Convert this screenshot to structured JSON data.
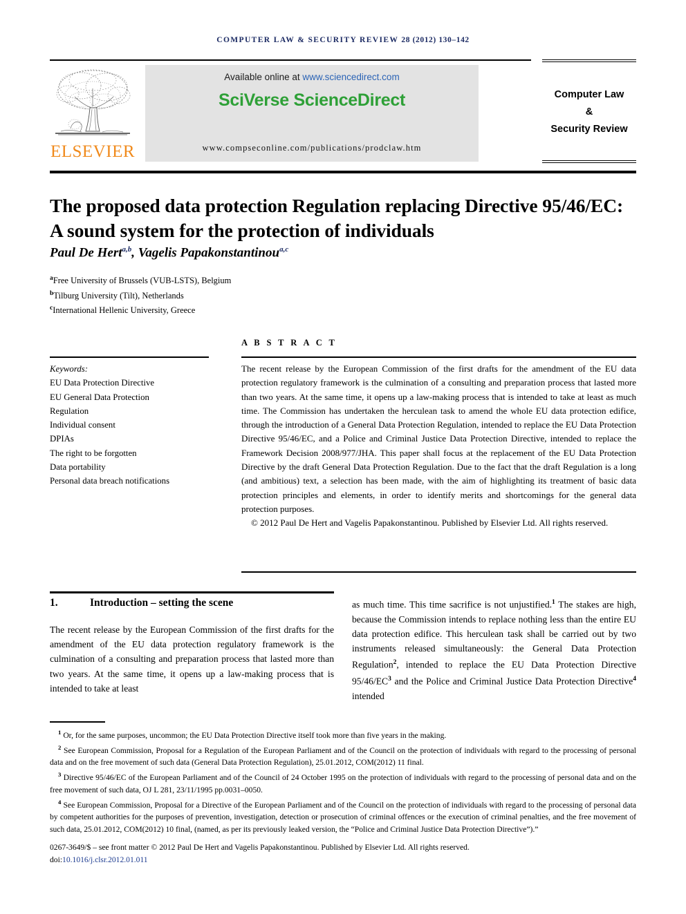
{
  "running_head": {
    "journal": "COMPUTER LAW & SECURITY REVIEW",
    "citation": "28 (2012) 130–142"
  },
  "masthead": {
    "publisher_name": "ELSEVIER",
    "available_prefix": "Available online at ",
    "sciencedirect_url": "www.sciencedirect.com",
    "platform_title": "SciVerse ScienceDirect",
    "journal_url": "www.compseconline.com/publications/prodclaw.htm",
    "journal_box": [
      "Computer Law",
      "&",
      "Security Review"
    ]
  },
  "article": {
    "title": "The proposed data protection Regulation replacing Directive 95/46/EC: A sound system for the protection of individuals",
    "authors": [
      {
        "name": "Paul De Hert",
        "marks": "a,b"
      },
      {
        "name": "Vagelis Papakonstantinou",
        "marks": "a,c"
      }
    ],
    "affiliations": [
      {
        "mark": "a",
        "text": "Free University of Brussels (VUB-LSTS), Belgium"
      },
      {
        "mark": "b",
        "text": "Tilburg University (Tilt), Netherlands"
      },
      {
        "mark": "c",
        "text": "International Hellenic University, Greece"
      }
    ]
  },
  "abstract": {
    "heading": "A B S T R A C T",
    "text": "The recent release by the European Commission of the first drafts for the amendment of the EU data protection regulatory framework is the culmination of a consulting and preparation process that lasted more than two years. At the same time, it opens up a law-making process that is intended to take at least as much time. The Commission has undertaken the herculean task to amend the whole EU data protection edifice, through the introduction of a General Data Protection Regulation, intended to replace the EU Data Protection Directive 95/46/EC, and a Police and Criminal Justice Data Protection Directive, intended to replace the Framework Decision 2008/977/JHA. This paper shall focus at the replacement of the EU Data Protection Directive by the draft General Data Protection Regulation. Due to the fact that the draft Regulation is a long (and ambitious) text, a selection has been made, with the aim of highlighting its treatment of basic data protection principles and elements, in order to identify merits and shortcomings for the general data protection purposes.",
    "copyright": "© 2012 Paul De Hert and Vagelis Papakonstantinou. Published by Elsevier Ltd. All rights reserved."
  },
  "keywords": {
    "label": "Keywords:",
    "items": [
      "EU Data Protection Directive",
      "EU General Data Protection",
      "Regulation",
      "Individual consent",
      "DPIAs",
      "The right to be forgotten",
      "Data portability",
      "Personal data breach notifications"
    ]
  },
  "section": {
    "number": "1.",
    "title": "Introduction – setting the scene",
    "column_left": "The recent release by the European Commission of the first drafts for the amendment of the EU data protection regulatory framework is the culmination of a consulting and preparation process that lasted more than two years. At the same time, it opens up a law-making process that is intended to take at least",
    "column_right_part1": "as much time. This time sacrifice is not unjustified.",
    "column_right_sup1": "1",
    "column_right_part2": " The stakes are high, because the Commission intends to replace nothing less than the entire EU data protection edifice. This herculean task shall be carried out by two instruments released simultaneously: the General Data Protection Regulation",
    "column_right_sup2": "2",
    "column_right_part3": ", intended to replace the EU Data Protection Directive 95/46/EC",
    "column_right_sup3": "3",
    "column_right_part4": " and the Police and Criminal Justice Data Protection Directive",
    "column_right_sup4": "4",
    "column_right_part5": " intended"
  },
  "footnotes": [
    {
      "mark": "1",
      "text": "Or, for the same purposes, uncommon; the EU Data Protection Directive itself took more than five years in the making."
    },
    {
      "mark": "2",
      "text": "See European Commission, Proposal for a Regulation of the European Parliament and of the Council on the protection of individuals with regard to the processing of personal data and on the free movement of such data (General Data Protection Regulation), 25.01.2012, COM(2012) 11 final."
    },
    {
      "mark": "3",
      "text": "Directive 95/46/EC of the European Parliament and of the Council of 24 October 1995 on the protection of individuals with regard to the processing of personal data and on the free movement of such data, OJ L 281, 23/11/1995 pp.0031–0050."
    },
    {
      "mark": "4",
      "text": "See European Commission, Proposal for a Directive of the European Parliament and of the Council on the protection of individuals with regard to the processing of personal data by competent authorities for the purposes of prevention, investigation, detection or prosecution of criminal offences or the execution of criminal penalties, and the free movement of such data, 25.01.2012, COM(2012) 10 final, (named, as per its previously leaked version, the “Police and Criminal Justice Data Protection Directive”).”"
    }
  ],
  "frontmatter": {
    "line": "0267-3649/$ – see front matter © 2012 Paul De Hert and Vagelis Papakonstantinou. Published by Elsevier Ltd. All rights reserved.",
    "doi_label": "doi:",
    "doi_value": "10.1016/j.clsr.2012.01.011"
  },
  "colors": {
    "running_head": "#1b2a63",
    "sciencedirect_green": "#2ea037",
    "link_blue": "#2b63b5",
    "elsevier_orange": "#f08a1c",
    "doi_blue": "#1b3a8f",
    "banner_grey": "#e3e3e3"
  }
}
